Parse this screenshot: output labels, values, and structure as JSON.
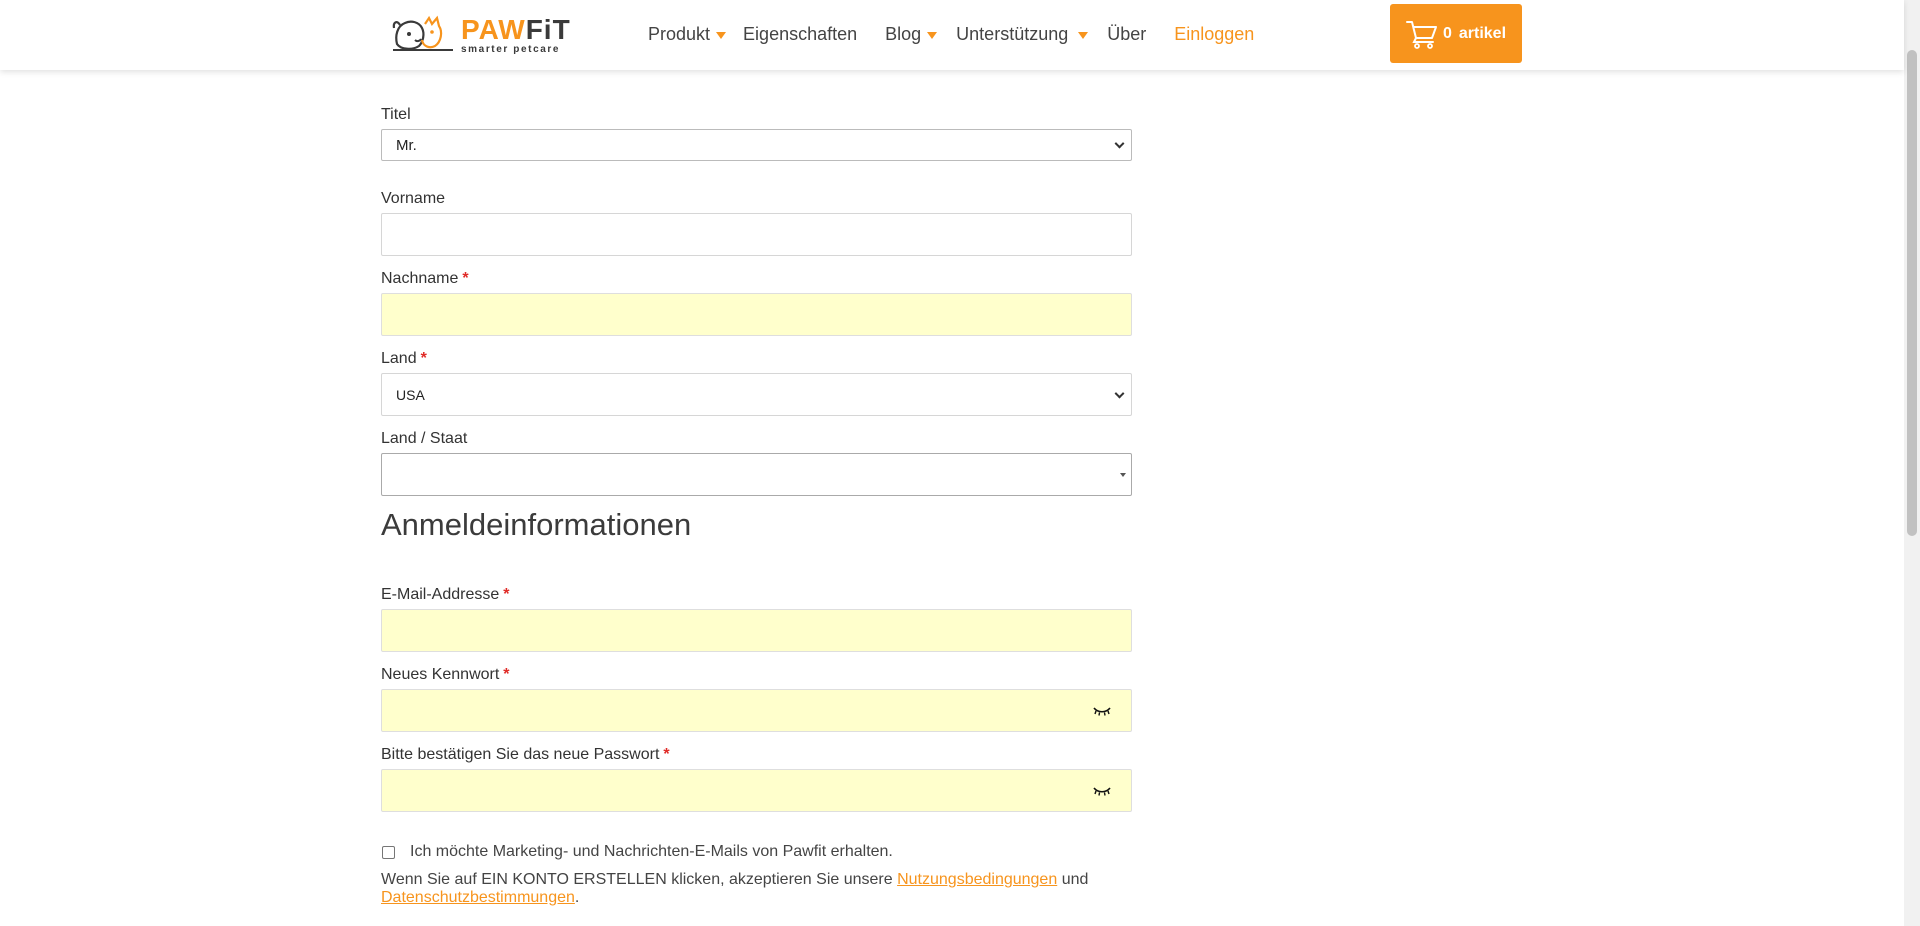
{
  "header": {
    "logo_word_paw": "PAW",
    "logo_word_fit": "FiT",
    "logo_tagline": "smarter petcare",
    "nav": [
      {
        "label": "Produkt",
        "has_dropdown": true
      },
      {
        "label": "Eigenschaften",
        "has_dropdown": false
      },
      {
        "label": "Blog",
        "has_dropdown": true
      },
      {
        "label": "Unterstützung",
        "has_dropdown": true
      },
      {
        "label": "Über",
        "has_dropdown": false
      },
      {
        "label": "Einloggen",
        "has_dropdown": false
      }
    ],
    "cart": {
      "icon": "cart-icon",
      "count": "0",
      "label": "artikel"
    }
  },
  "form": {
    "title": {
      "label": "Titel",
      "value": "Mr."
    },
    "firstname": {
      "label": "Vorname",
      "value": ""
    },
    "lastname": {
      "label": "Nachname",
      "required_mark": "*",
      "value": ""
    },
    "country": {
      "label": "Land",
      "required_mark": "*",
      "value": "USA"
    },
    "region": {
      "label": "Land / Staat",
      "value": ""
    },
    "section_heading": "Anmeldeinformationen",
    "email": {
      "label": "E-Mail-Addresse",
      "required_mark": "*",
      "value": ""
    },
    "password": {
      "label": "Neues Kennwort",
      "required_mark": "*",
      "value": "",
      "toggle_icon": "eye-closed-icon"
    },
    "password_confirm": {
      "label": "Bitte bestätigen Sie das neue Passwort",
      "required_mark": "*",
      "value": "",
      "toggle_icon": "eye-closed-icon"
    },
    "newsletter": {
      "label": "Ich möchte Marketing- und Nachrichten-E-Mails von Pawfit erhalten.",
      "checked": false
    },
    "terms": {
      "prefix": "Wenn Sie auf EIN KONTO ERSTELLEN klicken, akzeptieren Sie unsere",
      "link1": "Nutzungsbedingungen",
      "middle": "und",
      "link2": "Datenschutzbestimmungen",
      "suffix": "."
    }
  },
  "colors": {
    "accent": "#f7941d",
    "autofill_yellow": "#ffffcc",
    "required": "#e02b27"
  }
}
